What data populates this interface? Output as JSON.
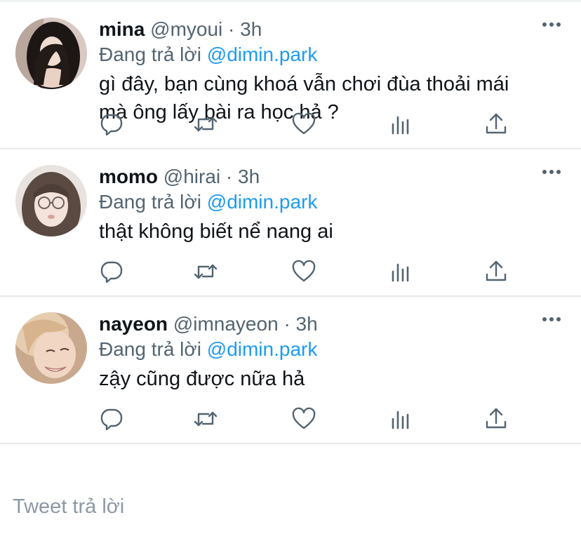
{
  "tweets": [
    {
      "name": "mina",
      "handle": "@myoui",
      "separator": "·",
      "time": "3h",
      "reply_prefix": "Đang trả lời",
      "reply_to": "@dimin.park",
      "text": "gì đây, bạn cùng khoá vẫn chơi đùa thoải mái\nmà ông lấy bài ra học hả ?"
    },
    {
      "name": "momo",
      "handle": "@hirai",
      "separator": "·",
      "time": "3h",
      "reply_prefix": "Đang trả lời",
      "reply_to": "@dimin.park",
      "text": "thật không biết nể nang ai"
    },
    {
      "name": "nayeon",
      "handle": "@imnayeon",
      "separator": "·",
      "time": "3h",
      "reply_prefix": "Đang trả lời",
      "reply_to": "@dimin.park",
      "text": "zậy cũng được nữa hả"
    }
  ],
  "composer": {
    "placeholder": "Tweet trả lời"
  },
  "icons": [
    "more-icon",
    "reply-icon",
    "retweet-icon",
    "like-icon",
    "stats-icon",
    "share-icon"
  ],
  "colors": {
    "accent": "#1d9bf0",
    "secondary_text": "#536471",
    "divider": "#e7e9ea"
  }
}
